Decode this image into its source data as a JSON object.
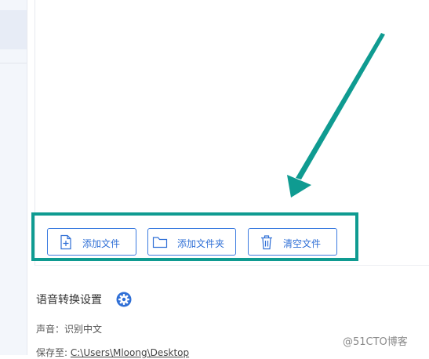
{
  "toolbar": {
    "add_file_label": "添加文件",
    "add_folder_label": "添加文件夹",
    "clear_label": "清空文件"
  },
  "settings": {
    "title": "语音转换设置",
    "voice_label": "声音：",
    "voice_value": "识别中文",
    "save_to_label": "保存至:",
    "save_to_path": "C:\\Users\\Mloong\\Desktop"
  },
  "watermark": "@51CTO博客",
  "colors": {
    "accent": "#2f6fd6",
    "annotation": "#0f9b91"
  },
  "icons": {
    "add_file": "add-file-icon",
    "add_folder": "folder-icon",
    "clear": "trash-icon",
    "settings": "gear-icon"
  }
}
